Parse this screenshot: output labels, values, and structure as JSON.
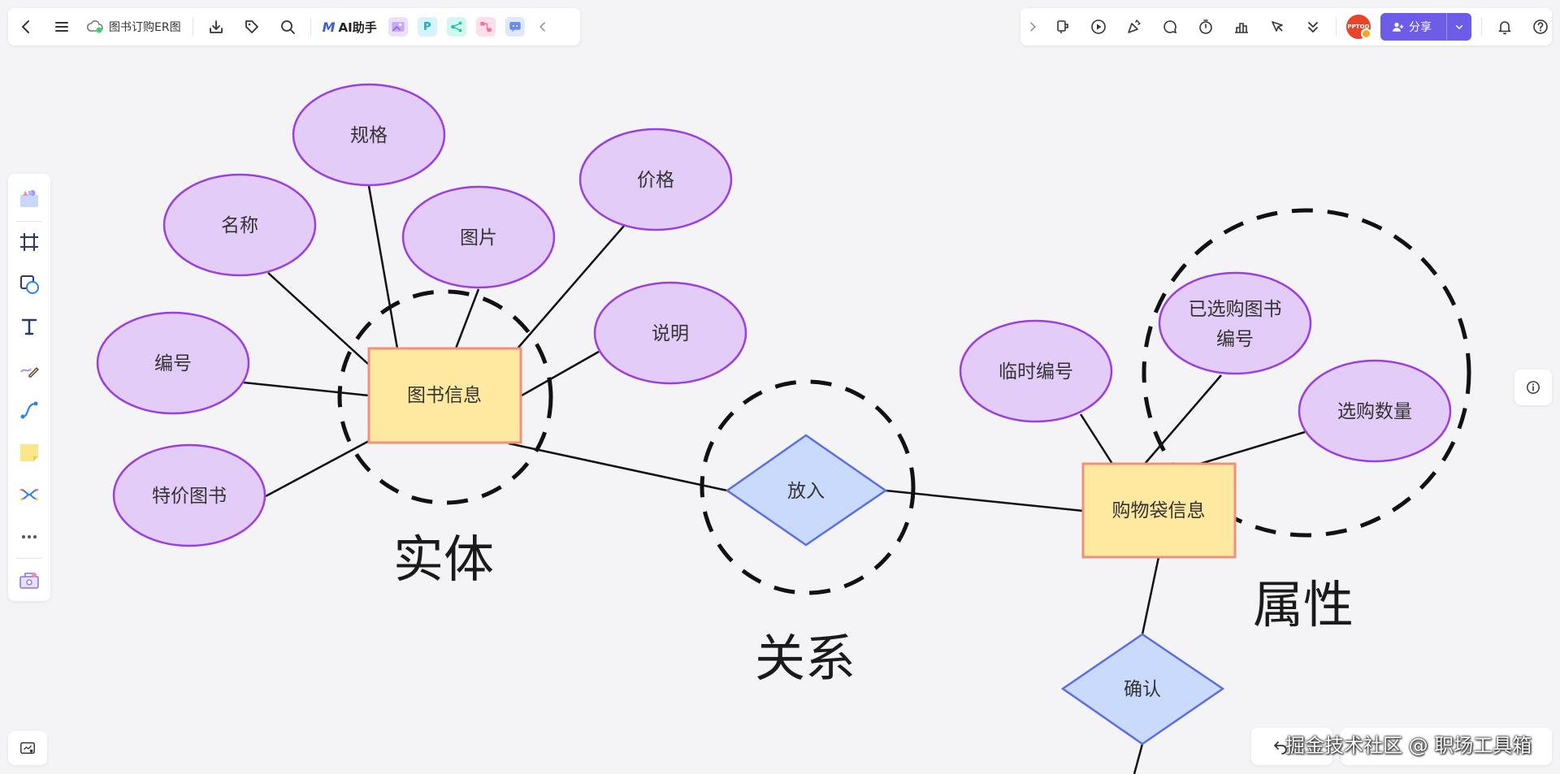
{
  "toolbar_left": {
    "document_title": "图书订购ER图",
    "ai_assistant_label": "AI助手",
    "ai_logo": "M",
    "mini_apps": [
      {
        "name": "image-app-icon",
        "glyph": "",
        "color": "#c9a7f2"
      },
      {
        "name": "p-app-icon",
        "glyph": "P",
        "color": "#34c3e8"
      },
      {
        "name": "mindmap-app-icon",
        "glyph": "<",
        "color": "#18c9a8"
      },
      {
        "name": "flow-app-icon",
        "glyph": "≺",
        "color": "#ff6b9a"
      },
      {
        "name": "chat-app-icon",
        "glyph": "⋯",
        "color": "#6a8cf0"
      }
    ]
  },
  "toolbar_right": {
    "avatar_text": "PPTOO",
    "share_label": "分享"
  },
  "diagram": {
    "entity_book": "图书信息",
    "entity_cart": "购物袋信息",
    "attr_spec": "规格",
    "attr_name": "名称",
    "attr_picture": "图片",
    "attr_price": "价格",
    "attr_desc": "说明",
    "attr_id": "编号",
    "attr_special": "特价图书",
    "attr_temp_id": "临时编号",
    "attr_selected_line1": "已选购图书",
    "attr_selected_line2": "编号",
    "attr_quantity": "选购数量",
    "rel_put": "放入",
    "rel_confirm": "确认",
    "label_entity": "实体",
    "label_relation": "关系",
    "label_attribute": "属性"
  },
  "watermark": "掘金技术社区 @ 职场工具箱",
  "colors": {
    "accent": "#6c5ce7",
    "attribute_fill": "#e3ccf8",
    "attribute_stroke": "#9b3fe0",
    "entity_fill": "#ffe9a0",
    "entity_stroke": "#f0907a",
    "relation_fill": "#c9dafc",
    "relation_stroke": "#5a6ee8"
  }
}
